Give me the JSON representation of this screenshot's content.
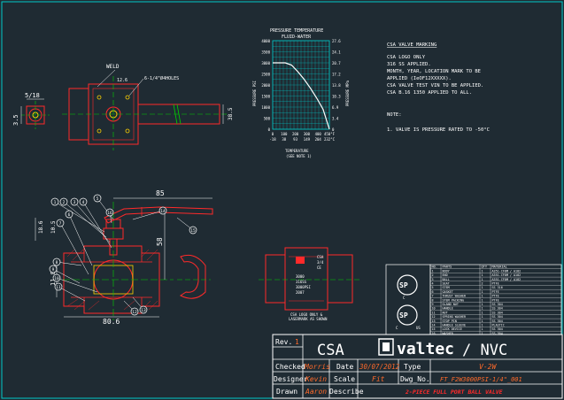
{
  "colors": {
    "background": "#1f2b33",
    "border": "#00c8c8",
    "part": "#ff2a2a",
    "dim": "#ffffff",
    "callout": "#ffffff",
    "green": "#00d200",
    "notes": "#ffffff",
    "yellow": "#ffd200",
    "orange_text": "#ff6a2a",
    "cyan": "#00d2d2",
    "titleblock_line": "#ffffff"
  },
  "top_view": {
    "weld_label": "WELD",
    "hole_label": "6-1/4\"Ø4HOLES",
    "dim_12_6": "12.6",
    "dim_width": "38.5",
    "dim_5_18": "5/18",
    "dim_side": "3.5"
  },
  "side_view": {
    "dim_top": "85",
    "dim_height": "58",
    "dim_18_6": "18.6",
    "dim_stem": "10.5",
    "dim_bore": "11.8",
    "dim_length": "80.6",
    "callouts": [
      "1",
      "2",
      "3",
      "4",
      "5",
      "6",
      "7",
      "8",
      "9",
      "10",
      "11",
      "12",
      "13",
      "14",
      "15",
      "16"
    ]
  },
  "pt_chart": {
    "title_line1": "PRESSURE TEMPERATURE",
    "title_line2": "FLUID-WATER",
    "ylabel_left": "PRESSURE PSI",
    "ylabel_right": "PRESSURE MPa",
    "xlabel_line1": "TEMPERATURE",
    "xlabel_line2": "(SEE NOTE 1)",
    "left_ticks": [
      "4000",
      "3500",
      "3000",
      "2500",
      "2000",
      "1500",
      "1000",
      "500",
      "0"
    ],
    "right_ticks": [
      "27.6",
      "24.1",
      "20.7",
      "17.2",
      "13.8",
      "10.3",
      "6.9",
      "3.4",
      "0"
    ],
    "x_ticks_f": [
      "0",
      "100",
      "200",
      "300",
      "400",
      "450°F"
    ],
    "x_ticks_c": [
      "-18",
      "38",
      "93",
      "149",
      "204",
      "232°C"
    ]
  },
  "chart_data": {
    "type": "line",
    "title": "PRESSURE TEMPERATURE",
    "subtitle": "FLUID-WATER",
    "xlabel": "TEMPERATURE",
    "ylabel": "PRESSURE PSI",
    "xlim": [
      0,
      450
    ],
    "ylim": [
      0,
      4000
    ],
    "grid": true,
    "series": [
      {
        "x": [
          0,
          100,
          150,
          200,
          250,
          300,
          350,
          400,
          450
        ],
        "y": [
          3000,
          3000,
          2900,
          2600,
          2250,
          1850,
          1400,
          900,
          0
        ]
      }
    ]
  },
  "csa_notes": {
    "heading": "CSA VALVE MARKING",
    "lines": [
      "CSA LOGO ONLY",
      "316 SS APPLIED.",
      "MONTH, YEAR, LOCATION MARK TO BE",
      "APPLIED (IeOF12XXXXX).",
      "CSA VALVE TEST VIN TO BE APPLIED.",
      "CSA B.16 1350 APPLIED TO ALL."
    ],
    "note_heading": "NOTE:",
    "note_lines": [
      "1. VALVE IS PRESSURE RATED TO -50°C"
    ]
  },
  "front_view": {
    "marking_lines": [
      "CSA",
      "3/4",
      "CE",
      "3000",
      "316SS",
      "3000PSI",
      "2007"
    ],
    "label_line1": "CSA LOGO ONLY &",
    "label_line2": "LASERMARK AS SHOWN"
  },
  "bom": {
    "headers": [
      "NO.",
      "PARTS",
      "QTY",
      "MATERIAL"
    ],
    "rows": [
      [
        "1",
        "BODY",
        "1",
        "A351-CF8M / A182"
      ],
      [
        "2",
        "END",
        "1",
        "A351-CF8M / A182"
      ],
      [
        "3",
        "BALL",
        "1",
        "A351-CF8M / A182"
      ],
      [
        "4",
        "SEAT",
        "2",
        "PTFE"
      ],
      [
        "5",
        "STEM",
        "1",
        "SS 316"
      ],
      [
        "6",
        "GASKET",
        "1",
        "PTFE"
      ],
      [
        "7",
        "THRUST WASHER",
        "1",
        "PTFE"
      ],
      [
        "8",
        "STEM PACKING",
        "1",
        "PTFE"
      ],
      [
        "9",
        "GLAND NUT",
        "1",
        "SS 304"
      ],
      [
        "10",
        "HANDLE",
        "1",
        "SS 304"
      ],
      [
        "11",
        "NUT",
        "1",
        "SS 304"
      ],
      [
        "12",
        "SPRING WASHER",
        "1",
        "SS 304"
      ],
      [
        "13",
        "STOP PIN",
        "1",
        "SS 304"
      ],
      [
        "14",
        "HANDLE SLEEVE",
        "1",
        "PLASTIC"
      ],
      [
        "15",
        "LOCK DEVICE",
        "1",
        "SS 304"
      ],
      [
        "16",
        "WASHER",
        "1",
        "SS 304"
      ]
    ]
  },
  "title_block": {
    "rev_label": "Rev.",
    "rev_value": "1",
    "csa": "CSA",
    "brand": "valtec",
    "brand_suffix": "/ NVC",
    "checked_label": "Checked",
    "checked_value": "Morris",
    "date_label": "Date",
    "date_value": "30/07/2012",
    "type_label": "Type",
    "type_value": "V-2W",
    "designer_label": "Designer",
    "designer_value": "Kevin",
    "scale_label": "Scale",
    "scale_value": "Fit",
    "dwg_label": "Dwg_No.",
    "dwg_value": "FT_F2W3000PSI-1/4\"_001",
    "drawn_label": "Drawn",
    "drawn_value": "Aaron",
    "describe_label": "Describe",
    "describe_value": "2-PIECE FULL PORT BALL VALVE"
  }
}
